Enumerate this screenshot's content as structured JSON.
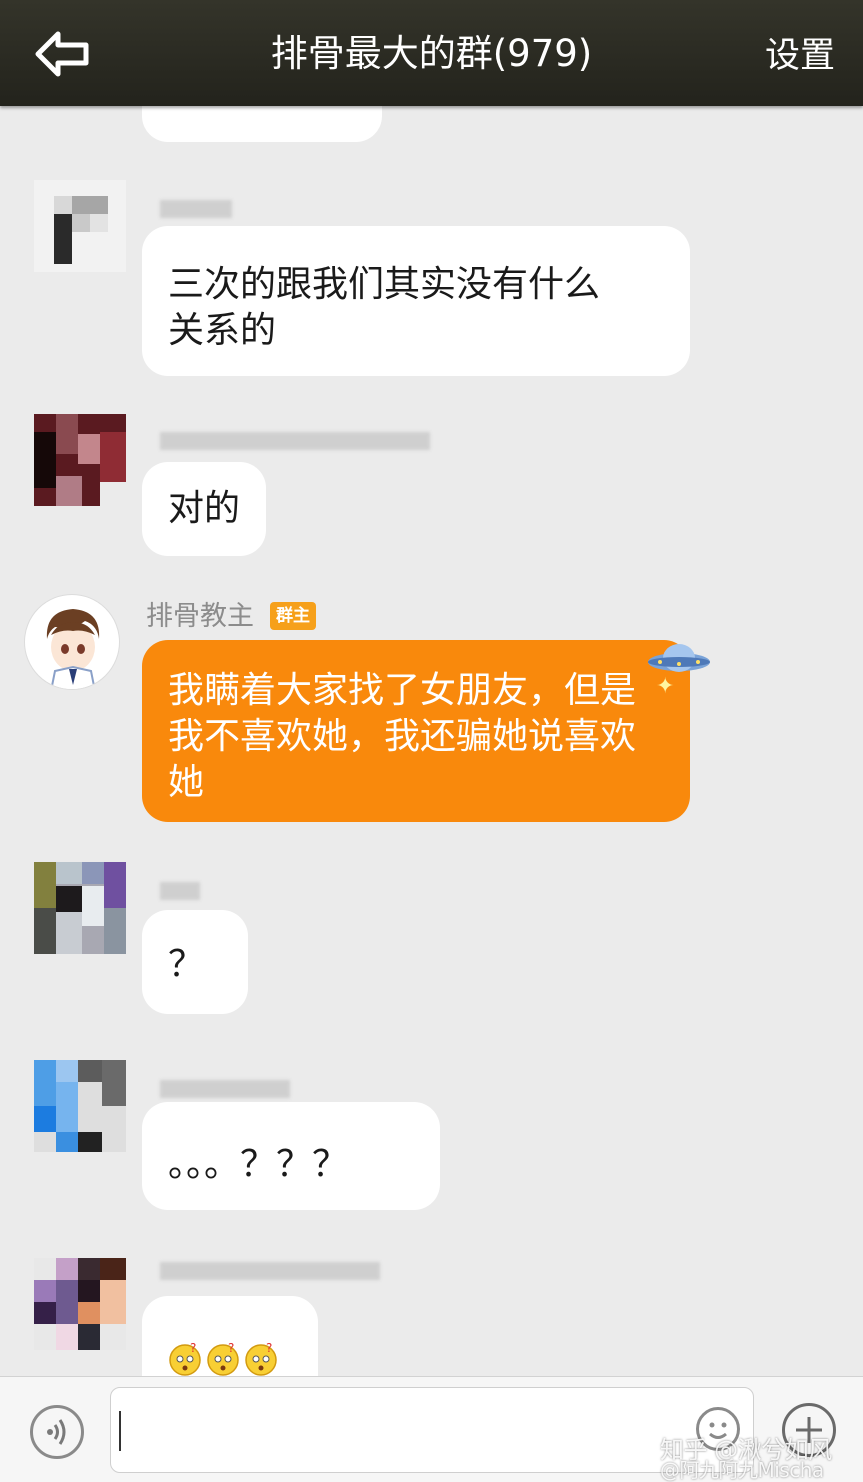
{
  "header": {
    "title": "排骨最大的群(979)",
    "settings_label": "设置",
    "back_icon": "back-arrow-icon"
  },
  "messages": [
    {
      "text": "",
      "partial": true
    },
    {
      "sender": "",
      "text": "三次的跟我们其实没有什么\n关系的"
    },
    {
      "sender": "",
      "text": "对的"
    },
    {
      "sender": "排骨教主",
      "badge": "群主",
      "text": "我瞒着大家找了女朋友，但是\n我不喜欢她，我还骗她说喜欢\n她",
      "bubble_color": "#f9890c",
      "decoration_icon": "ufo-sticker-icon"
    },
    {
      "sender": "",
      "text": "？"
    },
    {
      "sender": "",
      "text": "。。。？？？"
    },
    {
      "sender": "",
      "text": "",
      "emoji_icons": [
        "confused-face-icon",
        "confused-face-icon",
        "confused-face-icon"
      ]
    }
  ],
  "input_bar": {
    "voice_icon": "voice-icon",
    "input_placeholder": "",
    "emoji_icon": "smiley-icon",
    "plus_icon": "plus-icon"
  },
  "watermark": {
    "text": "知乎 @湫兮如风",
    "text2": "@阿九阿九Mischa"
  },
  "colors": {
    "header_bg": "#2c2c23",
    "chat_bg": "#ebebeb",
    "owner_bubble": "#f9890c",
    "badge": "#f6a01a"
  }
}
